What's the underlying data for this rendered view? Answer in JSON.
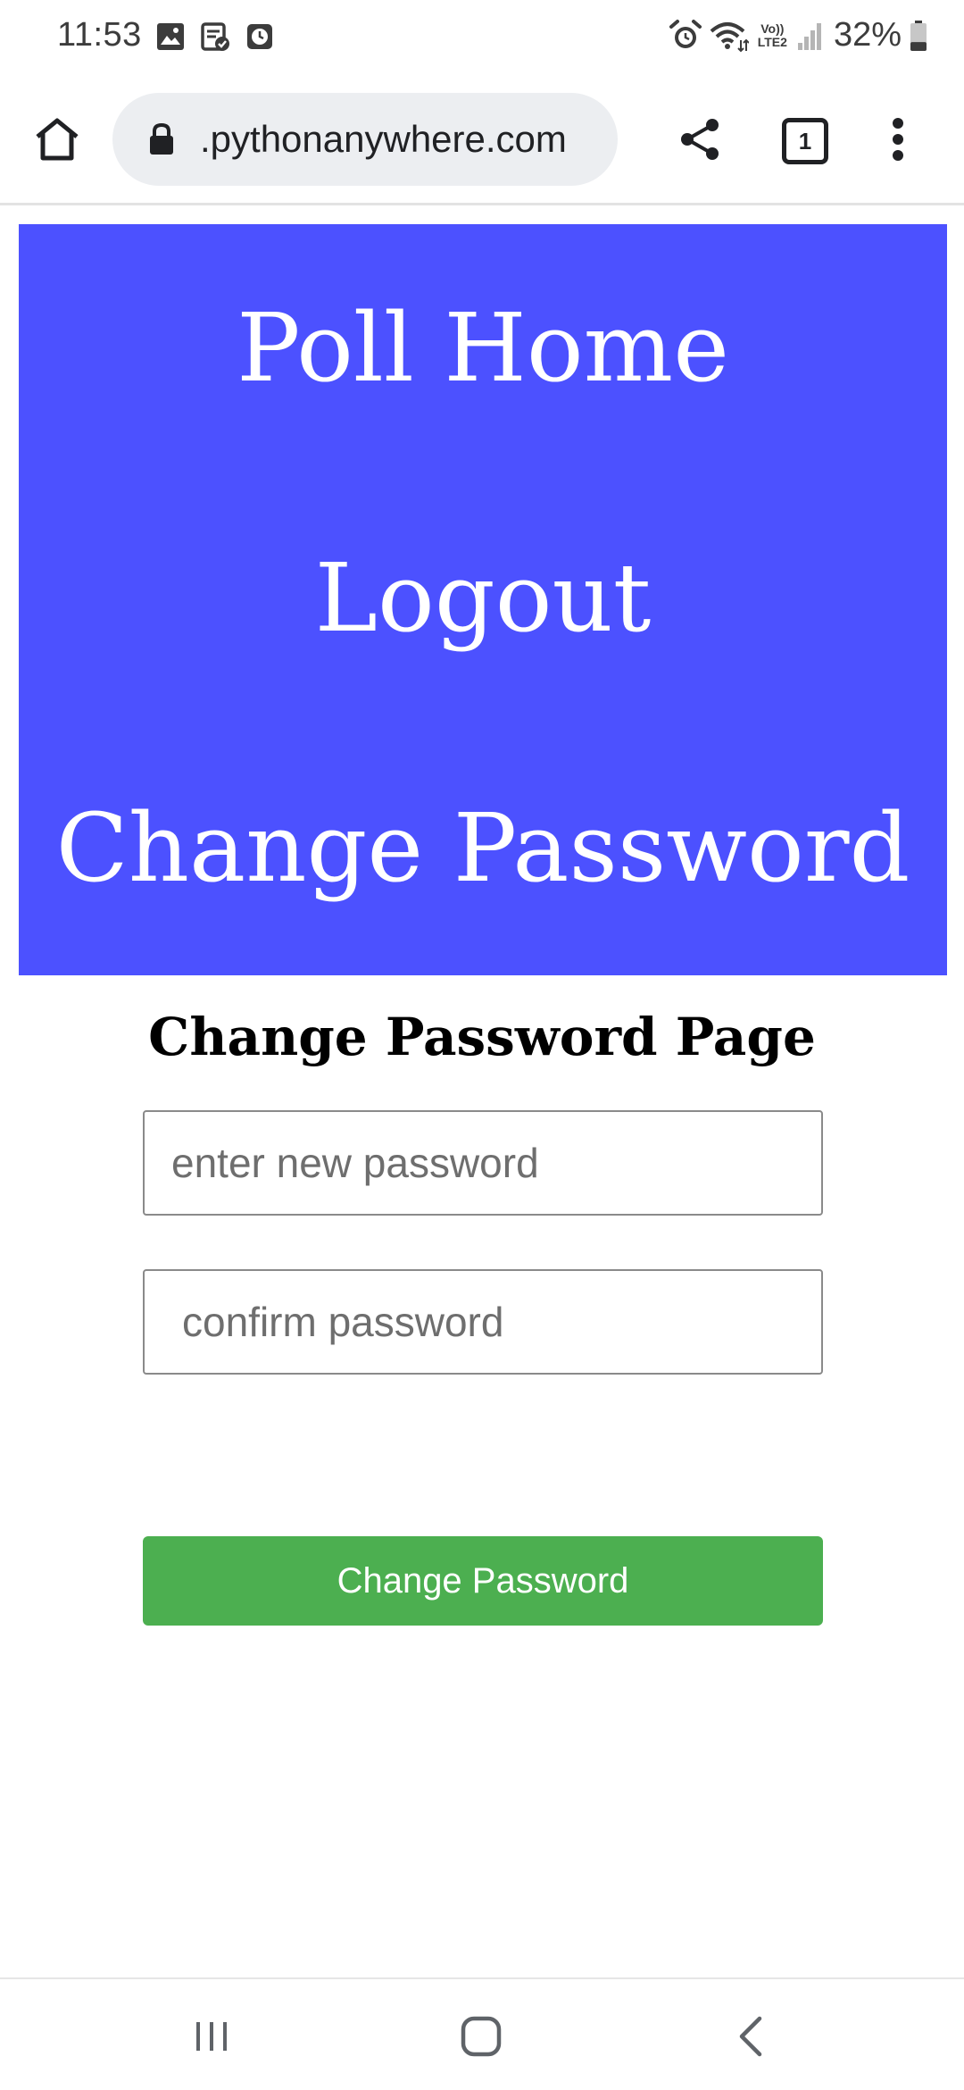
{
  "status_bar": {
    "time": "11:53",
    "battery_percent": "32%",
    "network_label_top": "Vo))",
    "network_label_bottom": "LTE2",
    "left_icons": [
      "gallery-icon",
      "task-icon",
      "clock-icon"
    ],
    "right_icons": [
      "alarm-icon",
      "wifi-icon",
      "volte-icon",
      "signal-icon",
      "battery-icon"
    ],
    "battery_level": 0.32
  },
  "browser": {
    "url": ".pythonanywhere.com",
    "tab_count": "1"
  },
  "nav": {
    "background_color": "#4c51ff",
    "links": [
      {
        "label": "Poll Home"
      },
      {
        "label": "Logout"
      },
      {
        "label": "Change Password"
      }
    ]
  },
  "page": {
    "heading": "Change Password Page",
    "new_password_placeholder": "enter new password",
    "confirm_password_placeholder": "confirm password",
    "submit_label": "Change Password",
    "submit_color": "#4caf50"
  }
}
